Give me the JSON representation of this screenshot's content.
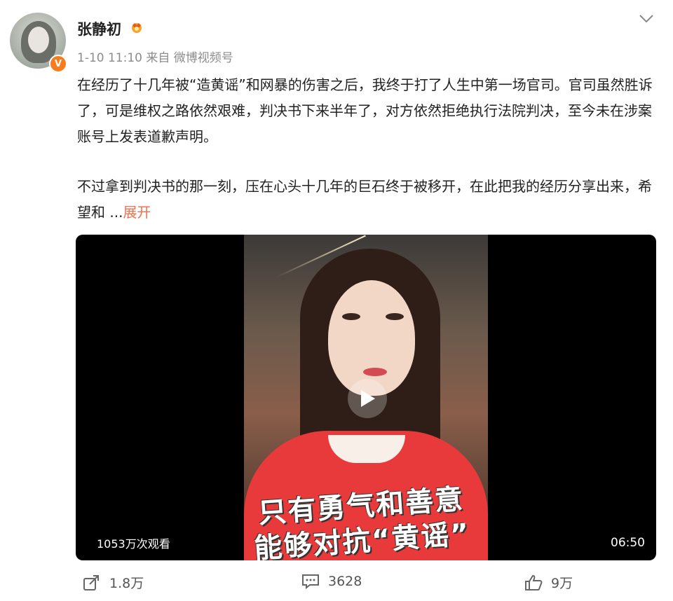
{
  "post": {
    "author_name": "张静初",
    "meta": "1-10 11:10  来自 微博视频号",
    "paragraph1": "在经历了十几年被“造黄谣”和网暴的伤害之后，我终于打了人生中第一场官司。官司虽然胜诉了，可是维权之路依然艰难，判决书下来半年了，对方依然拒绝执行法院判决，至今未在涉案账号上发表道歉声明。",
    "paragraph2": "  不过拿到判决书的那一刻，压在心头十几年的巨石终于被移开，在此把我的经历分享出来，希望和  ...",
    "expand_label": "展开"
  },
  "video": {
    "caption_line1": "只有勇气和善意",
    "caption_line2": "能够对抗“黄谣”",
    "views": "1053万次观看",
    "duration": "06:50"
  },
  "actions": {
    "share_count": "1.8万",
    "comment_count": "3628",
    "like_count": "9万"
  },
  "colors": {
    "accent": "#eb7350",
    "verified": "#f77c1d"
  }
}
